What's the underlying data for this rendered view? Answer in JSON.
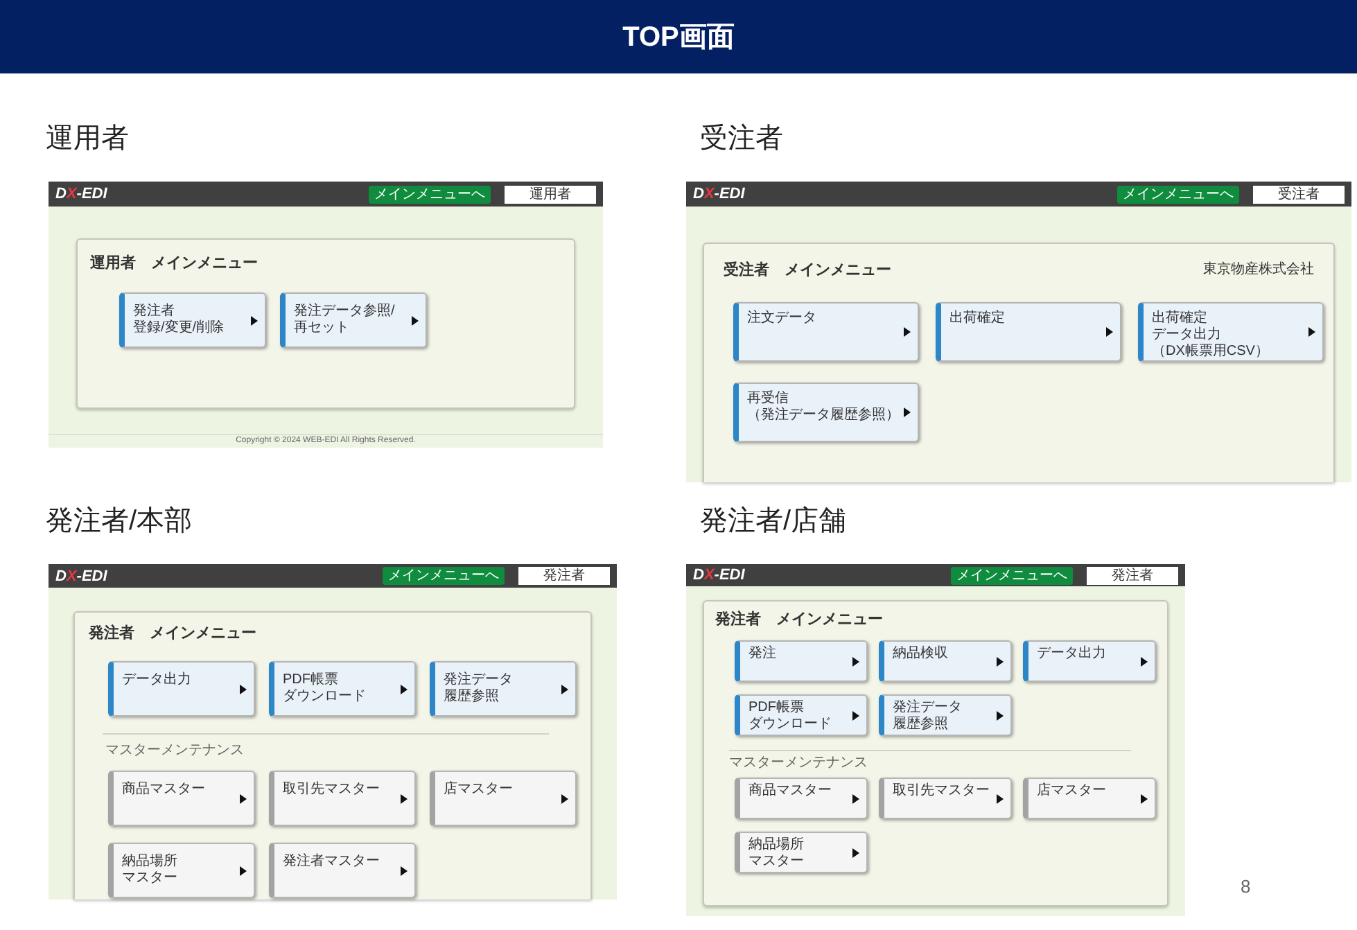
{
  "slide": {
    "title": "TOP画面",
    "page_number": "8"
  },
  "sections": [
    {
      "label": "運用者",
      "screen": {
        "logo": "DX-EDI",
        "menu_button": "メインメニューへ",
        "user": "運用者",
        "title": "運用者　メインメニュー",
        "groups": [
          {
            "kind": "main",
            "buttons": [
              {
                "lines": [
                  "発注者",
                  "登録/変更/削除"
                ]
              },
              {
                "lines": [
                  "発注データ参照/",
                  "再セット"
                ]
              }
            ]
          }
        ],
        "footer": "Copyright © 2024 WEB-EDI All Rights Reserved."
      }
    },
    {
      "label": "受注者",
      "screen": {
        "logo": "DX-EDI",
        "menu_button": "メインメニューへ",
        "user": "受注者",
        "title": "受注者　メインメニュー",
        "company": "東京物産株式会社",
        "groups": [
          {
            "kind": "main",
            "buttons": [
              {
                "lines": [
                  "注文データ"
                ]
              },
              {
                "lines": [
                  "出荷確定"
                ]
              },
              {
                "lines": [
                  "出荷確定",
                  "データ出力"
                ],
                "note": "（DX帳票用CSV）"
              },
              {
                "lines": [
                  "再受信"
                ],
                "note": "（発注データ履歴参照）"
              }
            ]
          }
        ]
      }
    },
    {
      "label": "発注者/本部",
      "screen": {
        "logo": "DX-EDI",
        "menu_button": "メインメニューへ",
        "user": "発注者",
        "title": "発注者　メインメニュー",
        "groups": [
          {
            "kind": "main",
            "buttons": [
              {
                "lines": [
                  "データ出力"
                ]
              },
              {
                "lines": [
                  "PDF帳票",
                  "ダウンロード"
                ]
              },
              {
                "lines": [
                  "発注データ",
                  "履歴参照"
                ]
              }
            ]
          },
          {
            "kind": "master",
            "heading": "マスターメンテナンス",
            "buttons": [
              {
                "lines": [
                  "商品マスター"
                ]
              },
              {
                "lines": [
                  "取引先マスター"
                ]
              },
              {
                "lines": [
                  "店マスター"
                ]
              },
              {
                "lines": [
                  "納品場所",
                  "マスター"
                ]
              },
              {
                "lines": [
                  "発注者マスター"
                ]
              }
            ]
          }
        ]
      }
    },
    {
      "label": "発注者/店舗",
      "screen": {
        "logo": "DX-EDI",
        "menu_button": "メインメニューへ",
        "user": "発注者",
        "title": "発注者　メインメニュー",
        "groups": [
          {
            "kind": "main",
            "buttons": [
              {
                "lines": [
                  "発注"
                ]
              },
              {
                "lines": [
                  "納品検収"
                ]
              },
              {
                "lines": [
                  "データ出力"
                ]
              },
              {
                "lines": [
                  "PDF帳票",
                  "ダウンロード"
                ]
              },
              {
                "lines": [
                  "発注データ",
                  "履歴参照"
                ]
              }
            ]
          },
          {
            "kind": "master",
            "heading": "マスターメンテナンス",
            "buttons": [
              {
                "lines": [
                  "商品マスター"
                ]
              },
              {
                "lines": [
                  "取引先マスター"
                ]
              },
              {
                "lines": [
                  "店マスター"
                ]
              },
              {
                "lines": [
                  "納品場所",
                  "マスター"
                ]
              }
            ]
          }
        ]
      }
    }
  ]
}
